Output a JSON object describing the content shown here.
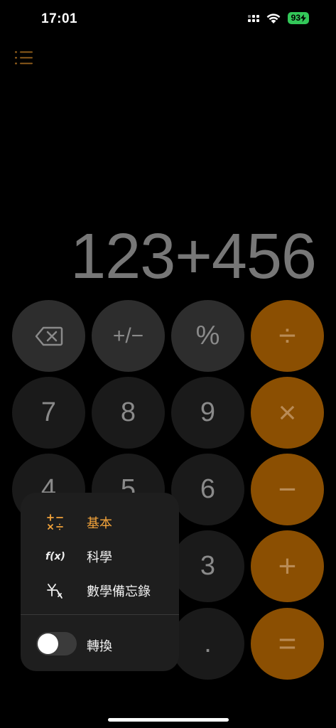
{
  "status": {
    "time": "17:01",
    "battery": "93"
  },
  "display": {
    "expression": "123+456"
  },
  "keys": {
    "backspace": "",
    "plus_minus": "+/−",
    "percent": "%",
    "divide": "÷",
    "seven": "7",
    "eight": "8",
    "nine": "9",
    "multiply": "×",
    "four": "4",
    "five": "5",
    "six": "6",
    "minus": "−",
    "three": "3",
    "plus": "+",
    "decimal": ".",
    "equals": "="
  },
  "menu": {
    "items": [
      {
        "label": "基本",
        "icon": "basic-operations-icon",
        "active": true
      },
      {
        "label": "科學",
        "icon": "function-icon",
        "icon_text": "f(x)",
        "active": false
      },
      {
        "label": "數學備忘錄",
        "icon": "math-notes-icon",
        "active": false
      }
    ],
    "toggle_label": "轉換",
    "toggle_on": false
  },
  "colors": {
    "accent": "#f2a33a",
    "orange_key": "#8b4f02",
    "gray_key": "#2d2d2d",
    "battery": "#33c759"
  }
}
